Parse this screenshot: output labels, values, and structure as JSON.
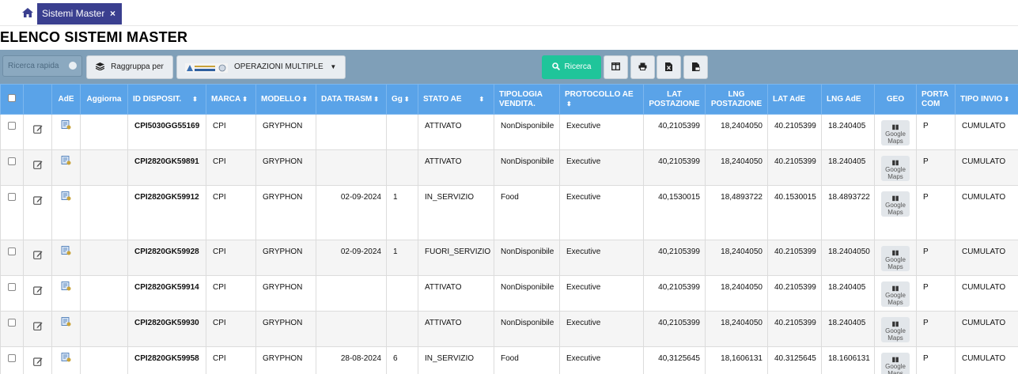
{
  "tabbar": {
    "tab_label": "Sistemi Master",
    "close_label": "×"
  },
  "page_title": "ELENCO SISTEMI MASTER",
  "toolbar": {
    "search_placeholder": "Ricerca rapida",
    "group_by_label": "Raggruppa per",
    "operations_label": "OPERAZIONI MULTIPLE",
    "search_button_label": "Ricerca",
    "accent_color": "#1fc59a",
    "header_color": "#5aa3e8"
  },
  "columns": [
    "",
    "",
    "AdE",
    "Aggiorna",
    "ID DISPOSIT.",
    "MARCA",
    "MODELLO",
    "DATA TRASM",
    "Gg",
    "STATO AE",
    "TIPOLOGIA VENDITA.",
    "PROTOCOLLO AE",
    "LAT POSTAZIONE",
    "LNG POSTAZIONE",
    "LAT AdE",
    "LNG AdE",
    "GEO",
    "PORTA COM",
    "TIPO INVIO"
  ],
  "geo_button_label": "Google Maps",
  "rows": [
    {
      "id": "CPI5030GG55169",
      "marca": "CPI",
      "modello": "GRYPHON",
      "data": "",
      "gg": "",
      "stato": "ATTIVATO",
      "tipologia": "NonDisponibile",
      "protocollo": "Executive",
      "lat_post": "40,2105399",
      "lng_post": "18,2404050",
      "lat_ade": "40.2105399",
      "lng_ade": "18.240405",
      "porta": "P",
      "tipo_invio": "CUMULATO"
    },
    {
      "id": "CPI2820GK59891",
      "marca": "CPI",
      "modello": "GRYPHON",
      "data": "",
      "gg": "",
      "stato": "ATTIVATO",
      "tipologia": "NonDisponibile",
      "protocollo": "Executive",
      "lat_post": "40,2105399",
      "lng_post": "18,2404050",
      "lat_ade": "40.2105399",
      "lng_ade": "18.240405",
      "porta": "P",
      "tipo_invio": "CUMULATO"
    },
    {
      "id": "CPI2820GK59912",
      "marca": "CPI",
      "modello": "GRYPHON",
      "data": "02-09-2024",
      "gg": "1",
      "stato": "IN_SERVIZIO",
      "tipologia": "Food",
      "protocollo": "Executive",
      "lat_post": "40,1530015",
      "lng_post": "18,4893722",
      "lat_ade": "40.1530015",
      "lng_ade": "18.4893722",
      "porta": "P",
      "tipo_invio": "CUMULATO"
    },
    {
      "id": "CPI2820GK59928",
      "marca": "CPI",
      "modello": "GRYPHON",
      "data": "02-09-2024",
      "gg": "1",
      "stato": "FUORI_SERVIZIO",
      "tipologia": "NonDisponibile",
      "protocollo": "Executive",
      "lat_post": "40,2105399",
      "lng_post": "18,2404050",
      "lat_ade": "40.2105399",
      "lng_ade": "18.2404050",
      "porta": "P",
      "tipo_invio": "CUMULATO"
    },
    {
      "id": "CPI2820GK59914",
      "marca": "CPI",
      "modello": "GRYPHON",
      "data": "",
      "gg": "",
      "stato": "ATTIVATO",
      "tipologia": "NonDisponibile",
      "protocollo": "Executive",
      "lat_post": "40,2105399",
      "lng_post": "18,2404050",
      "lat_ade": "40.2105399",
      "lng_ade": "18.240405",
      "porta": "P",
      "tipo_invio": "CUMULATO"
    },
    {
      "id": "CPI2820GK59930",
      "marca": "CPI",
      "modello": "GRYPHON",
      "data": "",
      "gg": "",
      "stato": "ATTIVATO",
      "tipologia": "NonDisponibile",
      "protocollo": "Executive",
      "lat_post": "40,2105399",
      "lng_post": "18,2404050",
      "lat_ade": "40.2105399",
      "lng_ade": "18.240405",
      "porta": "P",
      "tipo_invio": "CUMULATO"
    },
    {
      "id": "CPI2820GK59958",
      "marca": "CPI",
      "modello": "GRYPHON",
      "data": "28-08-2024",
      "gg": "6",
      "stato": "IN_SERVIZIO",
      "tipologia": "Food",
      "protocollo": "Executive",
      "lat_post": "40,3125645",
      "lng_post": "18,1606131",
      "lat_ade": "40.3125645",
      "lng_ade": "18.1606131",
      "porta": "P",
      "tipo_invio": "CUMULATO"
    }
  ]
}
